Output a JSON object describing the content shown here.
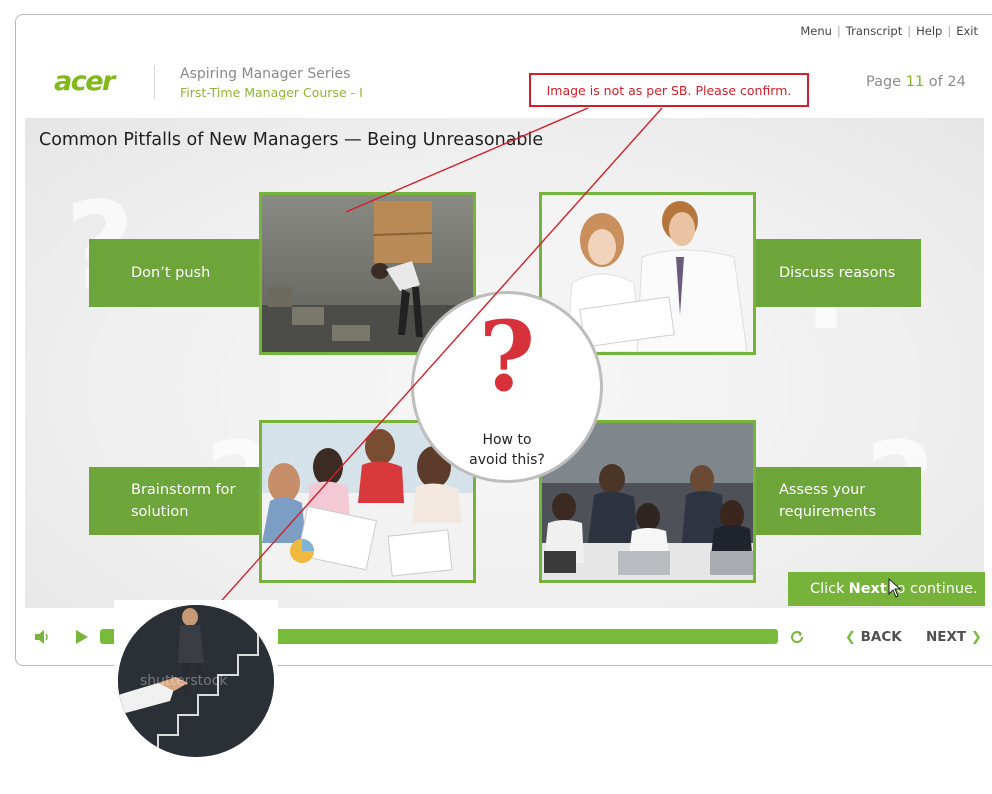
{
  "topnav": {
    "menu": "Menu",
    "transcript": "Transcript",
    "help": "Help",
    "exit": "Exit",
    "separator": "|"
  },
  "header": {
    "logo": "acer",
    "series": "Aspiring Manager Series",
    "course": "First-Time Manager Course - I",
    "page_prefix": "Page",
    "page_current": "11",
    "page_of": "of 24"
  },
  "review_comment": "Image is not as per SB. Please confirm.",
  "slide": {
    "title": "Common Pitfalls of New Managers — Being Unreasonable",
    "center_text_line1": "How to",
    "center_text_line2": "avoid this?",
    "center_glyph": "?",
    "boxes": {
      "top_left": "Don’t push",
      "top_right": "Discuss reasons",
      "bottom_left_line1": "Brainstorm for",
      "bottom_left_line2": "solution",
      "bottom_right_line1": "Assess your",
      "bottom_right_line2": "requirements"
    },
    "cta_before": "Click",
    "cta_bold": "Next",
    "cta_after": "to continue."
  },
  "player": {
    "back": "BACK",
    "next": "NEXT",
    "progress": 1.0
  },
  "thumbnail": {
    "watermark": "shutterstock"
  },
  "colors": {
    "accent_green": "#77b33a",
    "box_green": "#6ea53a",
    "comment_red": "#d0202b"
  },
  "icons": [
    "volume-icon",
    "play-icon",
    "replay-icon",
    "chevron-left-icon",
    "chevron-right-icon",
    "question-mark-icon",
    "cursor-icon"
  ]
}
